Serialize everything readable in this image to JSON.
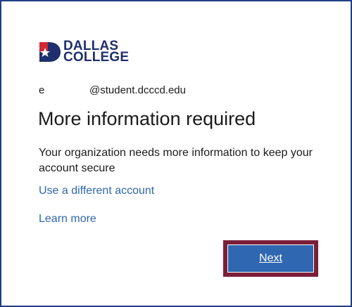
{
  "brand": {
    "line1": "DALLAS",
    "line2": "COLLEGE",
    "colors": {
      "navy": "#1f2f6e",
      "red": "#d22630"
    }
  },
  "account": {
    "user": "e",
    "domain": "@student.dcccd.edu"
  },
  "page": {
    "title": "More information required",
    "description": "Your organization needs more information to keep your account secure"
  },
  "links": {
    "different_account": "Use a different account",
    "learn_more": "Learn more"
  },
  "actions": {
    "next_label": "Next"
  },
  "colors": {
    "link": "#2f67b0",
    "button": "#2f67b0",
    "focus_ring": "#7b1e3a",
    "frame_border": "#1f3f86"
  }
}
